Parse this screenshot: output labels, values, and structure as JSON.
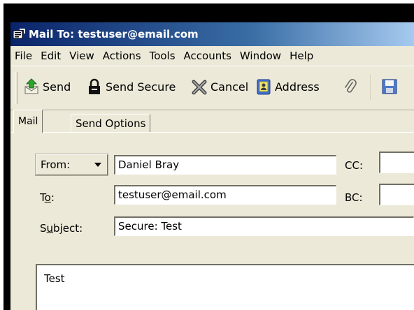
{
  "window": {
    "title": "Mail To: testuser@email.com",
    "title_icon": "compose-mail-icon"
  },
  "menubar": {
    "items": [
      "File",
      "Edit",
      "View",
      "Actions",
      "Tools",
      "Accounts",
      "Window",
      "Help"
    ]
  },
  "toolbar": {
    "send": {
      "label": "Send",
      "icon": "send-icon"
    },
    "send_secure": {
      "label": "Send Secure",
      "icon": "lock-icon"
    },
    "cancel": {
      "label": "Cancel",
      "icon": "cancel-icon"
    },
    "address": {
      "label": "Address",
      "icon": "address-book-icon"
    },
    "attach": {
      "icon": "paperclip-icon"
    },
    "save": {
      "icon": "save-icon"
    }
  },
  "tabs": [
    {
      "label": "Mail",
      "active": true
    },
    {
      "label": "Send Options",
      "active": false
    }
  ],
  "form": {
    "from_label": "From:",
    "from_value": "Daniel Bray",
    "to_label": "To:",
    "to_value": "testuser@email.com",
    "subject_label": "Subject:",
    "subject_value": "Secure: Test",
    "cc_label": "CC:",
    "cc_value": "",
    "bc_label": "BC:",
    "bc_value": "",
    "body": "Test"
  },
  "colors": {
    "title_bar_start": "#0a246a",
    "title_bar_end": "#a6caf0",
    "window_face": "#ece9d8"
  }
}
